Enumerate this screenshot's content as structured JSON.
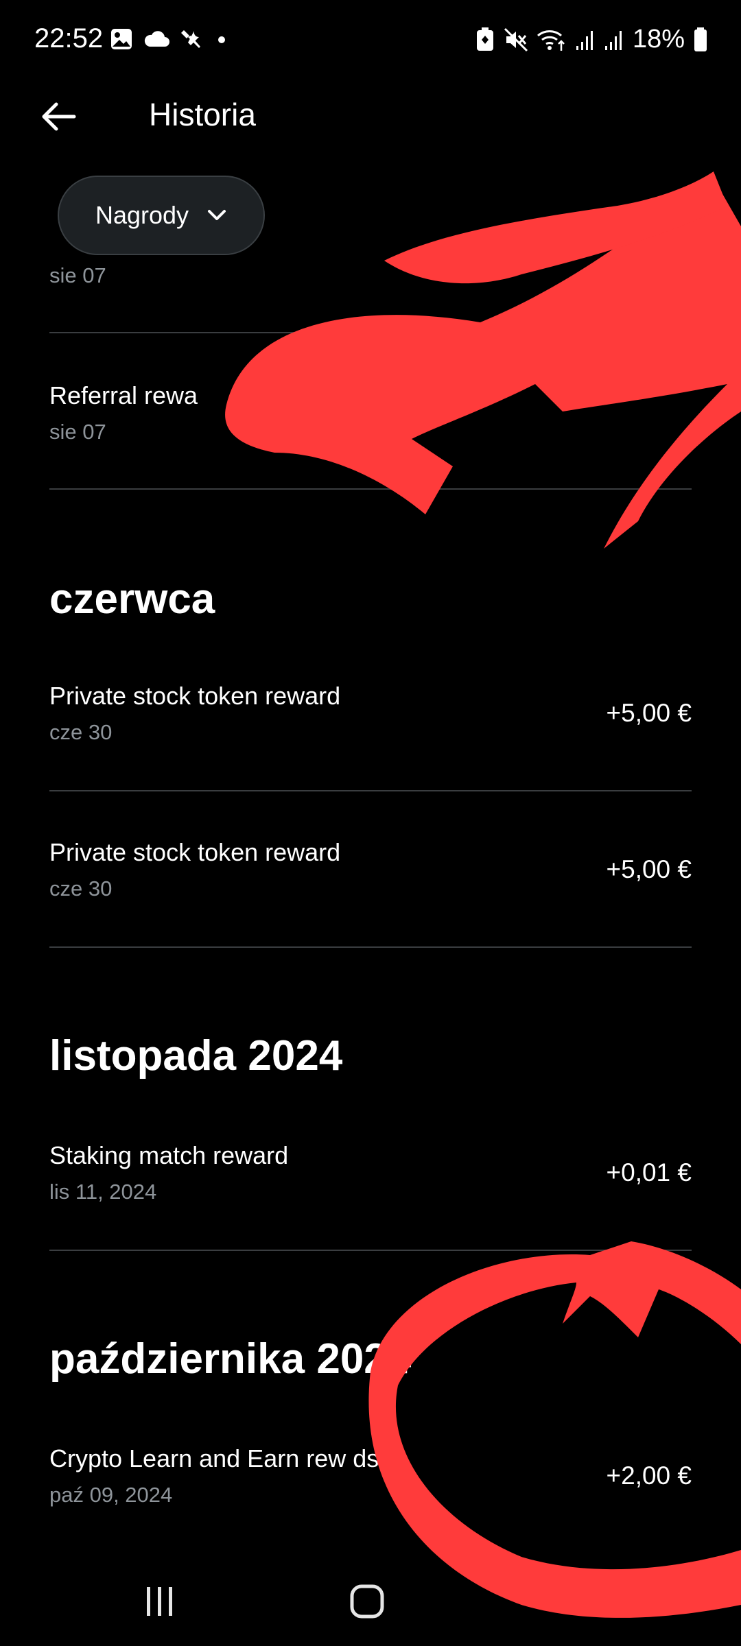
{
  "status_bar": {
    "time": "22:52",
    "battery": "18%",
    "icons_left": [
      "gallery-icon",
      "cloud-icon",
      "tools-icon",
      "dot-icon"
    ],
    "icons_right": [
      "battery-saver-icon",
      "mute-icon",
      "wifi-icon",
      "signal-icon",
      "signal-icon",
      "battery-icon"
    ]
  },
  "header": {
    "title": "Historia",
    "back_icon": "arrow-left-icon"
  },
  "filter": {
    "label": "Nagrody",
    "icon": "chevron-down-icon"
  },
  "colors": {
    "background": "#000000",
    "chip_background": "#1d2124",
    "secondary_text": "#8e949a",
    "divider": "#3a3d40",
    "scribble": "#ff3b3b"
  },
  "top_rows": [
    {
      "title": "",
      "date": "sie 07",
      "amount": ""
    },
    {
      "title": "Referral rewa",
      "date": "sie 07",
      "amount": ""
    }
  ],
  "sections": [
    {
      "header": "czerwca",
      "rows": [
        {
          "title": "Private stock token reward",
          "date": "cze 30",
          "amount": "+5,00 €"
        },
        {
          "title": "Private stock token reward",
          "date": "cze 30",
          "amount": "+5,00 €"
        }
      ]
    },
    {
      "header": "listopada 2024",
      "rows": [
        {
          "title": "Staking match reward",
          "date": "lis 11, 2024",
          "amount": "+0,01 €"
        }
      ]
    },
    {
      "header": "października 2024",
      "rows": [
        {
          "title": "Crypto Learn and Earn rew  ds",
          "date": "paź 09, 2024",
          "amount": "+2,00 €"
        }
      ]
    }
  ],
  "nav": {
    "recents_icon": "recents-icon",
    "home_icon": "home-icon"
  }
}
